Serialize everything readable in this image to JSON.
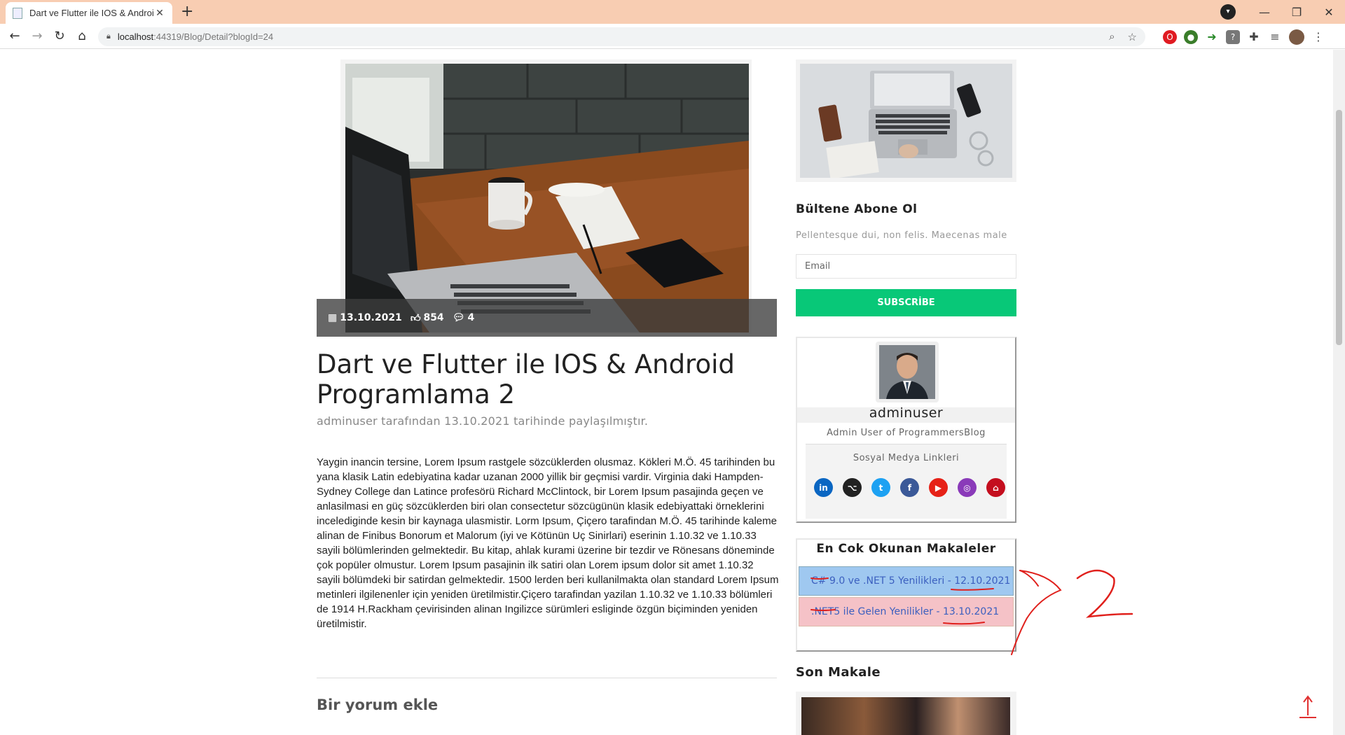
{
  "browser": {
    "tab_title": "Dart ve Flutter ile IOS & Android",
    "tab_close": "✕",
    "new_tab": "+",
    "url_host": "localhost",
    "url_path": ":44319/Blog/Detail?blogId=24"
  },
  "post": {
    "date": "13.10.2021",
    "likes": "854",
    "comments": "4",
    "title": "Dart ve Flutter ile IOS & Android Programlama 2",
    "subtitle": "adminuser tarafından 13.10.2021 tarihinde paylaşılmıştır.",
    "body": "Yaygin inancin tersine, Lorem Ipsum rastgele sözcüklerden olusmaz. Kökleri M.Ö. 45 tarihinden bu yana klasik Latin edebiyatina kadar uzanan 2000 yillik bir geçmisi vardir. Virginia daki Hampden-Sydney College dan Latince profesörü Richard McClintock, bir Lorem Ipsum pasajinda geçen ve anlasilmasi en güç sözcüklerden biri olan consectetur sözcügünün klasik edebiyattaki örneklerini incelediginde kesin bir kaynaga ulasmistir. Lorm Ipsum, Çiçero tarafindan M.Ö. 45 tarihinde kaleme alinan de Finibus Bonorum et Malorum (iyi ve Kötünün Uç Sinirlari) eserinin 1.10.32 ve 1.10.33 sayili bölümlerinden gelmektedir. Bu kitap, ahlak kurami üzerine bir tezdir ve Rönesans döneminde çok popüler olmustur. Lorem Ipsum pasajinin ilk satiri olan Lorem ipsum dolor sit amet 1.10.32 sayili bölümdeki bir satirdan gelmektedir. 1500 lerden beri kullanilmakta olan standard Lorem Ipsum metinleri ilgilenenler için yeniden üretilmistir.Çiçero tarafindan yazilan 1.10.32 ve 1.10.33 bölümleri de 1914 H.Rackham çevirisinden alinan Ingilizce sürümleri esliginde özgün biçiminden yeniden üretilmistir.",
    "comment_heading": "Bir yorum ekle"
  },
  "sidebar": {
    "newsletter_title": "Bültene Abone Ol",
    "newsletter_text": "Pellentesque dui, non felis. Maecenas male",
    "email_placeholder": "Email",
    "subscribe_label": "SUBSCRİBE",
    "author": {
      "name": "adminuser",
      "description": "Admin User of ProgrammersBlog",
      "social_title": "Sosyal Medya Linkleri",
      "social": [
        {
          "name": "linkedin-icon",
          "glyph": "in",
          "color": "#0a66c2"
        },
        {
          "name": "github-icon",
          "glyph": "⌥",
          "color": "#222222"
        },
        {
          "name": "twitter-icon",
          "glyph": "t",
          "color": "#1da1f2"
        },
        {
          "name": "facebook-icon",
          "glyph": "f",
          "color": "#3b5998"
        },
        {
          "name": "youtube-icon",
          "glyph": "▶",
          "color": "#e62117"
        },
        {
          "name": "instagram-icon",
          "glyph": "◎",
          "color": "#8a3ab9"
        },
        {
          "name": "website-icon",
          "glyph": "⌂",
          "color": "#c40e1e"
        }
      ]
    },
    "popular_title": "En Cok Okunan Makaleler",
    "popular": [
      {
        "label": "C# 9.0 ve .NET 5 Yenilikleri - 12.10.2021"
      },
      {
        "label": ".NET5 ile Gelen Yenilikler - 13.10.2021"
      }
    ],
    "latest_title": "Son Makale"
  },
  "annotation": {
    "text": "2",
    "color": "#e0201c"
  }
}
